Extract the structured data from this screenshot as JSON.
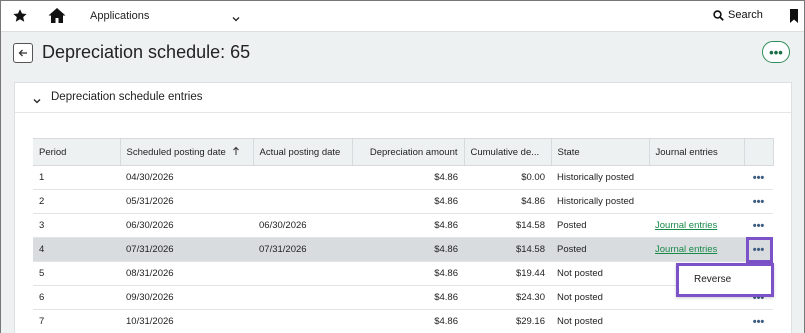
{
  "topbar": {
    "applications_label": "Applications",
    "search_label": "Search"
  },
  "header": {
    "title": "Depreciation schedule: 65",
    "more_label": "•••"
  },
  "section": {
    "title": "Depreciation schedule entries"
  },
  "table": {
    "columns": {
      "period": "Period",
      "scheduled": "Scheduled posting date",
      "actual": "Actual posting date",
      "amount": "Depreciation amount",
      "cumulative": "Cumulative de...",
      "state": "State",
      "journal": "Journal entries"
    },
    "row_more_label": "•••",
    "rows": [
      {
        "period": "1",
        "scheduled": "04/30/2026",
        "actual": "",
        "amount": "$4.86",
        "cumulative": "$0.00",
        "state": "Historically posted",
        "journal": ""
      },
      {
        "period": "2",
        "scheduled": "05/31/2026",
        "actual": "",
        "amount": "$4.86",
        "cumulative": "$4.86",
        "state": "Historically posted",
        "journal": ""
      },
      {
        "period": "3",
        "scheduled": "06/30/2026",
        "actual": "06/30/2026",
        "amount": "$4.86",
        "cumulative": "$14.58",
        "state": "Posted",
        "journal": "Journal entries"
      },
      {
        "period": "4",
        "scheduled": "07/31/2026",
        "actual": "07/31/2026",
        "amount": "$4.86",
        "cumulative": "$14.58",
        "state": "Posted",
        "journal": "Journal entries"
      },
      {
        "period": "5",
        "scheduled": "08/31/2026",
        "actual": "",
        "amount": "$4.86",
        "cumulative": "$19.44",
        "state": "Not posted",
        "journal": ""
      },
      {
        "period": "6",
        "scheduled": "09/30/2026",
        "actual": "",
        "amount": "$4.86",
        "cumulative": "$24.30",
        "state": "Not posted",
        "journal": ""
      },
      {
        "period": "7",
        "scheduled": "10/31/2026",
        "actual": "",
        "amount": "$4.86",
        "cumulative": "$29.16",
        "state": "Not posted",
        "journal": ""
      }
    ]
  },
  "context_menu": {
    "reverse_label": "Reverse"
  },
  "colors": {
    "accent_green": "#1a8a4a",
    "highlight_purple": "#7b52c8",
    "header_bg": "#eef1f2"
  }
}
